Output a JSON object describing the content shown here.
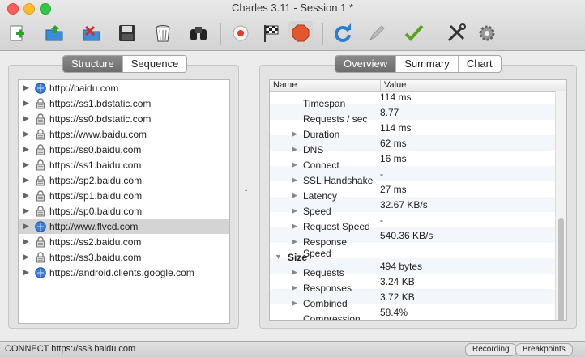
{
  "window": {
    "title": "Charles 3.11 - Session 1 *"
  },
  "toolbar": {
    "items": [
      {
        "name": "new-session-icon"
      },
      {
        "name": "open-session-icon"
      },
      {
        "name": "close-session-icon"
      },
      {
        "name": "save-icon"
      },
      {
        "name": "trash-icon"
      },
      {
        "name": "find-binoculars-icon"
      },
      {
        "name": "record-icon"
      },
      {
        "name": "throttle-flag-icon"
      },
      {
        "name": "breakpoint-stop-icon"
      },
      {
        "name": "refresh-icon"
      },
      {
        "name": "edit-pencil-icon"
      },
      {
        "name": "validate-check-icon"
      },
      {
        "name": "tools-icon"
      },
      {
        "name": "settings-gear-icon"
      }
    ]
  },
  "left_panel": {
    "tabs": [
      {
        "label": "Structure",
        "active": true
      },
      {
        "label": "Sequence",
        "active": false
      }
    ],
    "hosts": [
      {
        "label": "http://baidu.com",
        "type": "http"
      },
      {
        "label": "https://ss1.bdstatic.com",
        "type": "https"
      },
      {
        "label": "https://ss0.bdstatic.com",
        "type": "https"
      },
      {
        "label": "https://www.baidu.com",
        "type": "https"
      },
      {
        "label": "https://ss0.baidu.com",
        "type": "https"
      },
      {
        "label": "https://ss1.baidu.com",
        "type": "https"
      },
      {
        "label": "https://sp2.baidu.com",
        "type": "https"
      },
      {
        "label": "https://sp1.baidu.com",
        "type": "https"
      },
      {
        "label": "https://sp0.baidu.com",
        "type": "https"
      },
      {
        "label": "http://www.flvcd.com",
        "type": "http",
        "selected": true
      },
      {
        "label": "https://ss2.baidu.com",
        "type": "https"
      },
      {
        "label": "https://ss3.baidu.com",
        "type": "https"
      },
      {
        "label": "https://android.clients.google.com",
        "type": "http"
      }
    ]
  },
  "right_panel": {
    "tabs": [
      {
        "label": "Overview",
        "active": true
      },
      {
        "label": "Summary",
        "active": false
      },
      {
        "label": "Chart",
        "active": false
      }
    ],
    "columns": {
      "name": "Name",
      "value": "Value"
    },
    "rows": [
      {
        "name": "Timespan",
        "value": "114 ms",
        "expandable": false,
        "clipped": true
      },
      {
        "name": "Requests / sec",
        "value": "8.77",
        "expandable": false
      },
      {
        "name": "Duration",
        "value": "114 ms",
        "expandable": true
      },
      {
        "name": "DNS",
        "value": "62 ms",
        "expandable": true
      },
      {
        "name": "Connect",
        "value": "16 ms",
        "expandable": true
      },
      {
        "name": "SSL Handshake",
        "value": "-",
        "expandable": true
      },
      {
        "name": "Latency",
        "value": "27 ms",
        "expandable": true
      },
      {
        "name": "Speed",
        "value": "32.67 KB/s",
        "expandable": true
      },
      {
        "name": "Request Speed",
        "value": "-",
        "expandable": true
      },
      {
        "name": "Response Speed",
        "value": "540.36 KB/s",
        "expandable": true
      },
      {
        "name": "Size",
        "value": "",
        "section": true
      },
      {
        "name": "Requests",
        "value": "494 bytes",
        "expandable": true
      },
      {
        "name": "Responses",
        "value": "3.24 KB",
        "expandable": true
      },
      {
        "name": "Combined",
        "value": "3.72 KB",
        "expandable": true
      },
      {
        "name": "Compression",
        "value": "58.4%",
        "expandable": false
      }
    ]
  },
  "statusbar": {
    "text": "CONNECT https://ss3.baidu.com",
    "recording_label": "Recording",
    "breakpoints_label": "Breakpoints"
  }
}
